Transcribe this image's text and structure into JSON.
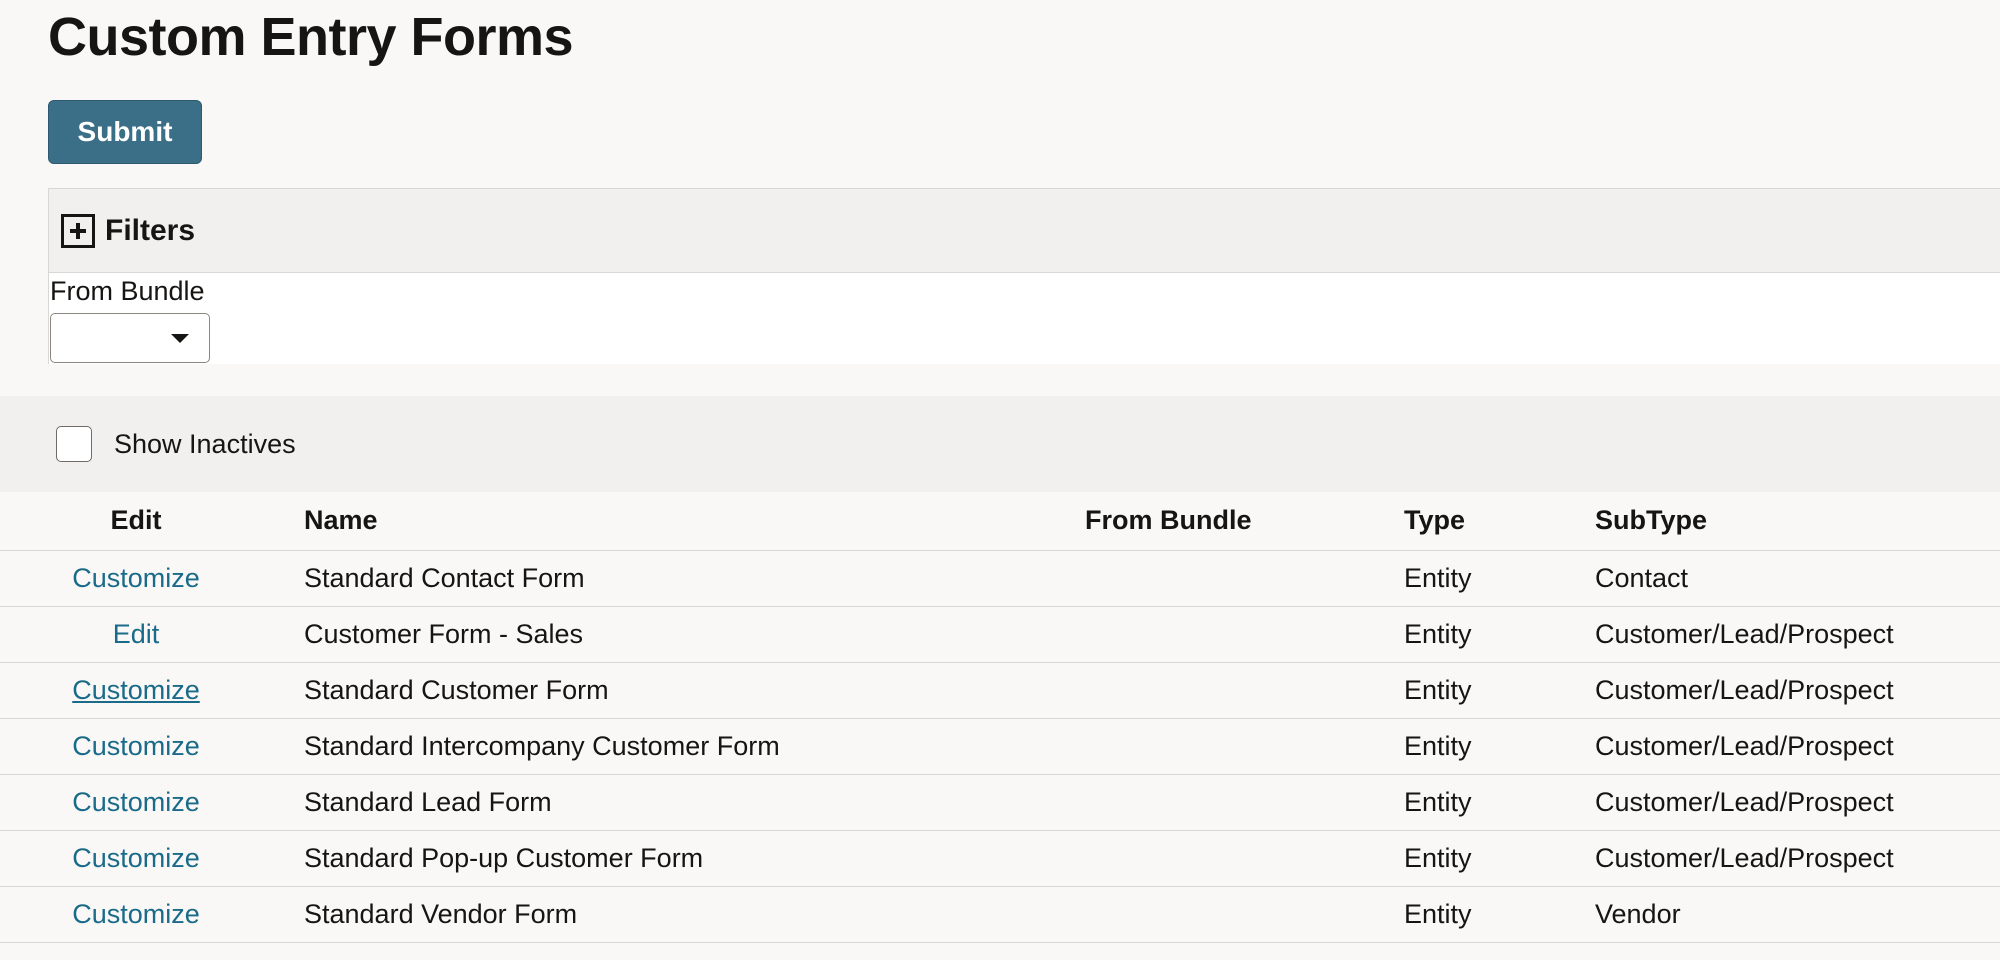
{
  "page": {
    "title": "Custom Entry Forms"
  },
  "toolbar": {
    "submit_label": "Submit"
  },
  "filters": {
    "header_label": "Filters",
    "from_bundle_label": "From Bundle",
    "from_bundle_value": ""
  },
  "options": {
    "show_inactives_label": "Show Inactives",
    "show_inactives_checked": false
  },
  "table": {
    "headers": {
      "edit": "Edit",
      "name": "Name",
      "from_bundle": "From Bundle",
      "type": "Type",
      "subtype": "SubType"
    },
    "rows": [
      {
        "action": "Customize",
        "name": "Standard Contact Form",
        "from_bundle": "",
        "type": "Entity",
        "subtype": "Contact"
      },
      {
        "action": "Edit",
        "name": "Customer Form - Sales",
        "from_bundle": "",
        "type": "Entity",
        "subtype": "Customer/Lead/Prospect"
      },
      {
        "action": "Customize",
        "name": "Standard Customer Form",
        "from_bundle": "",
        "type": "Entity",
        "subtype": "Customer/Lead/Prospect",
        "hovered": true
      },
      {
        "action": "Customize",
        "name": "Standard Intercompany Customer Form",
        "from_bundle": "",
        "type": "Entity",
        "subtype": "Customer/Lead/Prospect"
      },
      {
        "action": "Customize",
        "name": "Standard Lead Form",
        "from_bundle": "",
        "type": "Entity",
        "subtype": "Customer/Lead/Prospect"
      },
      {
        "action": "Customize",
        "name": "Standard Pop-up Customer Form",
        "from_bundle": "",
        "type": "Entity",
        "subtype": "Customer/Lead/Prospect"
      },
      {
        "action": "Customize",
        "name": "Standard Vendor Form",
        "from_bundle": "",
        "type": "Entity",
        "subtype": "Vendor"
      }
    ]
  },
  "colors": {
    "primary_button": "#3b6e87",
    "link": "#1a6a8a",
    "panel_background": "#f1f0ee",
    "page_background": "#f9f8f6"
  },
  "icons": {
    "filters_toggle": "plus-square-icon",
    "select_caret": "caret-down-icon"
  }
}
